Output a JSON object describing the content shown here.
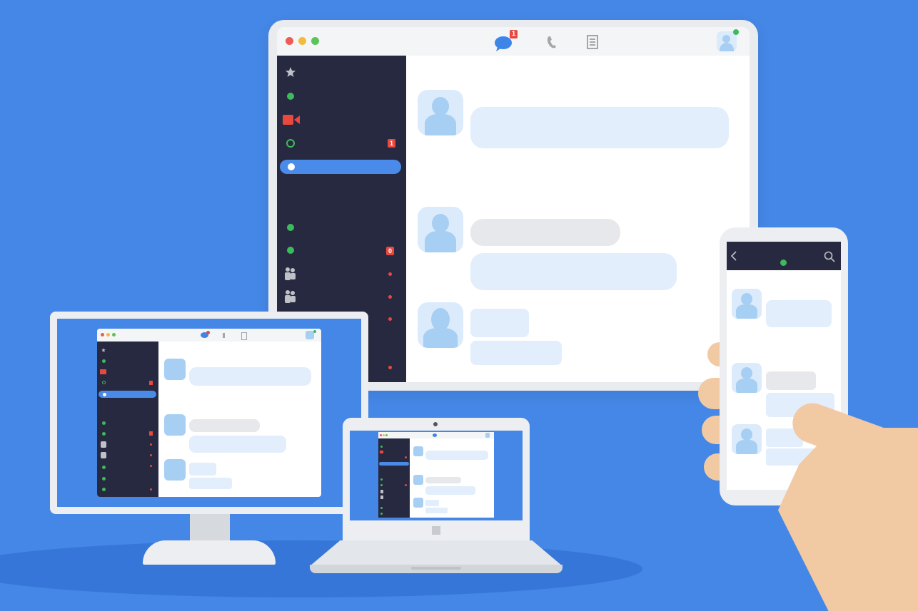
{
  "chat_badge": "1",
  "sidebar_badges": {
    "first": "1",
    "second": "0"
  },
  "colors": {
    "background": "#4587e6",
    "sidebar": "#272940",
    "active_item": "#4a8ae8",
    "online": "#3dbb5c",
    "badge": "#e8483e",
    "bubble_blue": "#e2eefb",
    "bubble_gray": "#e6e8eb"
  },
  "icons": {
    "header": [
      "chat-icon",
      "phone-icon",
      "contacts-icon",
      "profile-avatar-icon"
    ],
    "sidebar": [
      "star-icon",
      "video-camera-icon",
      "group-icon"
    ],
    "phone_header": [
      "back-arrow-icon",
      "search-icon"
    ]
  }
}
